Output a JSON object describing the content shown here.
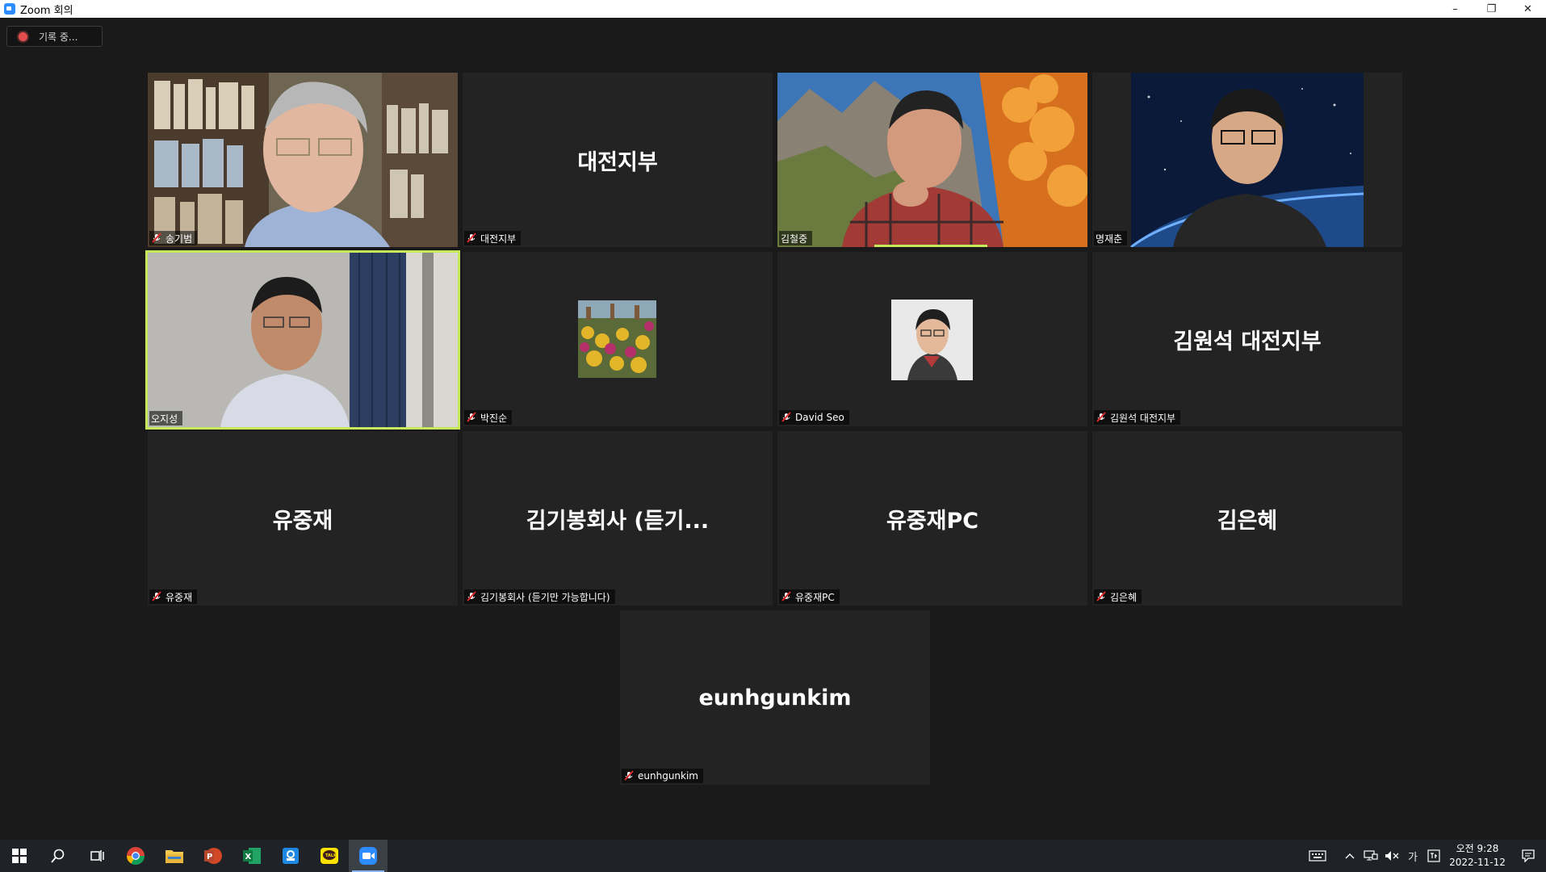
{
  "window": {
    "title": "Zoom 회의",
    "minimize": "–",
    "restore": "❐",
    "close": "✕"
  },
  "recording": {
    "label": "기록 중..."
  },
  "tiles": [
    {
      "display_name": "송기범",
      "big_text": ""
    },
    {
      "display_name": "대전지부",
      "big_text": "대전지부"
    },
    {
      "display_name": "김철중",
      "big_text": ""
    },
    {
      "display_name": "명재춘",
      "big_text": ""
    },
    {
      "display_name": "오지성",
      "big_text": ""
    },
    {
      "display_name": "박진순",
      "big_text": ""
    },
    {
      "display_name": "David Seo",
      "big_text": ""
    },
    {
      "display_name": "김원석 대전지부",
      "big_text": "김원석 대전지부"
    },
    {
      "display_name": "유중재",
      "big_text": "유중재"
    },
    {
      "display_name": "김기봉회사 (듣기만 가능합니다)",
      "big_text": "김기봉회사 (듣기..."
    },
    {
      "display_name": "유중재PC",
      "big_text": "유중재PC"
    },
    {
      "display_name": "김은혜",
      "big_text": "김은혜"
    },
    {
      "display_name": "eunhgunkim",
      "big_text": "eunhgunkim"
    }
  ],
  "taskbar": {
    "apps": [
      "windows-start",
      "search",
      "task-view",
      "chrome",
      "file-explorer",
      "powerpoint",
      "excel",
      "app-blue",
      "kakaotalk",
      "zoom"
    ],
    "tray": {
      "ime": "가",
      "time": "오전 9:28",
      "date": "2022-11-12"
    }
  },
  "colors": {
    "active_speaker": "#c7e85a",
    "zoom_blue": "#2D8CFF",
    "tile_bg": "#232323"
  }
}
